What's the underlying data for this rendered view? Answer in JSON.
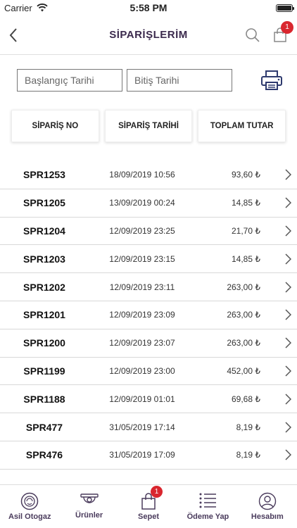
{
  "status_bar": {
    "carrier": "Carrier",
    "time": "5:58 PM"
  },
  "header": {
    "title": "SİPARİŞLERİM",
    "cart_count": "1"
  },
  "filters": {
    "start_placeholder": "Başlangıç Tarihi",
    "end_placeholder": "Bitiş Tarihi"
  },
  "columns": [
    "SİPARİŞ NO",
    "SİPARİŞ TARİHİ",
    "TOPLAM TUTAR"
  ],
  "orders": [
    {
      "no": "SPR1253",
      "date": "18/09/2019 10:56",
      "total": "93,60 ₺"
    },
    {
      "no": "SPR1205",
      "date": "13/09/2019 00:24",
      "total": "14,85 ₺"
    },
    {
      "no": "SPR1204",
      "date": "12/09/2019 23:25",
      "total": "21,70 ₺"
    },
    {
      "no": "SPR1203",
      "date": "12/09/2019 23:15",
      "total": "14,85 ₺"
    },
    {
      "no": "SPR1202",
      "date": "12/09/2019 23:11",
      "total": "263,00 ₺"
    },
    {
      "no": "SPR1201",
      "date": "12/09/2019 23:09",
      "total": "263,00 ₺"
    },
    {
      "no": "SPR1200",
      "date": "12/09/2019 23:07",
      "total": "263,00 ₺"
    },
    {
      "no": "SPR1199",
      "date": "12/09/2019 23:00",
      "total": "452,00 ₺"
    },
    {
      "no": "SPR1188",
      "date": "12/09/2019 01:01",
      "total": "69,68 ₺"
    },
    {
      "no": "SPR477",
      "date": "31/05/2019 17:14",
      "total": "8,19 ₺"
    },
    {
      "no": "SPR476",
      "date": "31/05/2019 17:09",
      "total": "8,19 ₺"
    }
  ],
  "tabs": [
    {
      "label": "Asil Otogaz",
      "icon": "brand-logo-icon"
    },
    {
      "label": "Ürünler",
      "icon": "products-icon"
    },
    {
      "label": "Sepet",
      "icon": "cart-icon",
      "badge": "1"
    },
    {
      "label": "Ödeme Yap",
      "icon": "payment-list-icon"
    },
    {
      "label": "Hesabım",
      "icon": "account-icon"
    }
  ],
  "colors": {
    "accent": "#3b2a4d",
    "badge": "#d9262e"
  }
}
